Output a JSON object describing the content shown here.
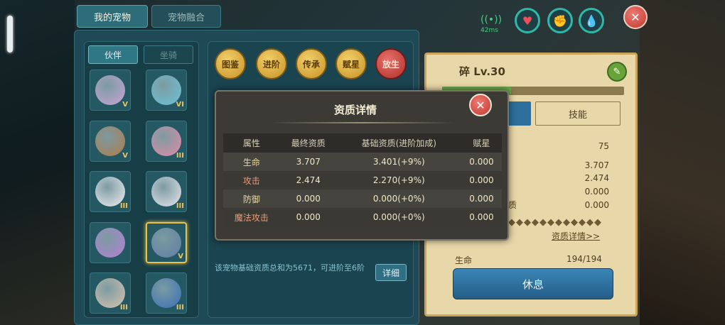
{
  "header": {
    "tabs": [
      {
        "label": "我的宠物",
        "active": true
      },
      {
        "label": "宠物融合",
        "active": false
      }
    ]
  },
  "hud": {
    "ping": "42ms",
    "icons": [
      "wifi-icon",
      "heart-icon",
      "muscle-icon",
      "water-drop-icon"
    ],
    "close_icon": "close-icon"
  },
  "pet_list": {
    "sub_tabs": [
      {
        "label": "伙伴",
        "active": true
      },
      {
        "label": "坐骑",
        "active": false
      }
    ],
    "pets": [
      {
        "color": "#c9a3d8",
        "badge": "V"
      },
      {
        "color": "#6cc3d8",
        "badge": "VI"
      },
      {
        "color": "#b07a4a",
        "badge": "V"
      },
      {
        "color": "#e58aa8",
        "badge": "III"
      },
      {
        "color": "#f0f0f4",
        "badge": "III"
      },
      {
        "color": "#e8e6ef",
        "badge": "III"
      },
      {
        "color": "#b47fd6",
        "badge": ""
      },
      {
        "color": "#5f7ea6",
        "badge": "V",
        "selected": true
      },
      {
        "color": "#d9c2b0",
        "badge": "III"
      },
      {
        "color": "#3a6fb8",
        "badge": "III"
      }
    ]
  },
  "actions": {
    "buttons": [
      "图鉴",
      "进阶",
      "传承",
      "赋星",
      "放生"
    ],
    "info_text": "该宠物基础资质总和为5671，可进阶至6阶",
    "detail_button": "详细"
  },
  "pet_detail": {
    "title": "碎 Lv.30",
    "hp_progress": 0.38,
    "skill_tab": "技能",
    "values": [
      "75",
      "3.707",
      "2.474",
      "0.000",
      "0.000"
    ],
    "label_partial": "质",
    "diamonds": "◆◆◆◆◆◆◆◆◆◆◆◆",
    "aptitude_link": "资质详情>>",
    "hp_label": "生命",
    "hp_value": "194/194",
    "rest_button": "休息"
  },
  "modal": {
    "title": "资质详情",
    "columns": [
      "属性",
      "最终资质",
      "基础资质(进阶加成)",
      "赋星"
    ],
    "rows": [
      {
        "name": "生命",
        "final": "3.707",
        "base": "3.401(+9%)",
        "star": "0.000",
        "tone": "gold"
      },
      {
        "name": "攻击",
        "final": "2.474",
        "base": "2.270(+9%)",
        "star": "0.000",
        "tone": "pink"
      },
      {
        "name": "防御",
        "final": "0.000",
        "base": "0.000(+0%)",
        "star": "0.000",
        "tone": "gold"
      },
      {
        "name": "魔法攻击",
        "final": "0.000",
        "base": "0.000(+0%)",
        "star": "0.000",
        "tone": "pink"
      }
    ]
  }
}
